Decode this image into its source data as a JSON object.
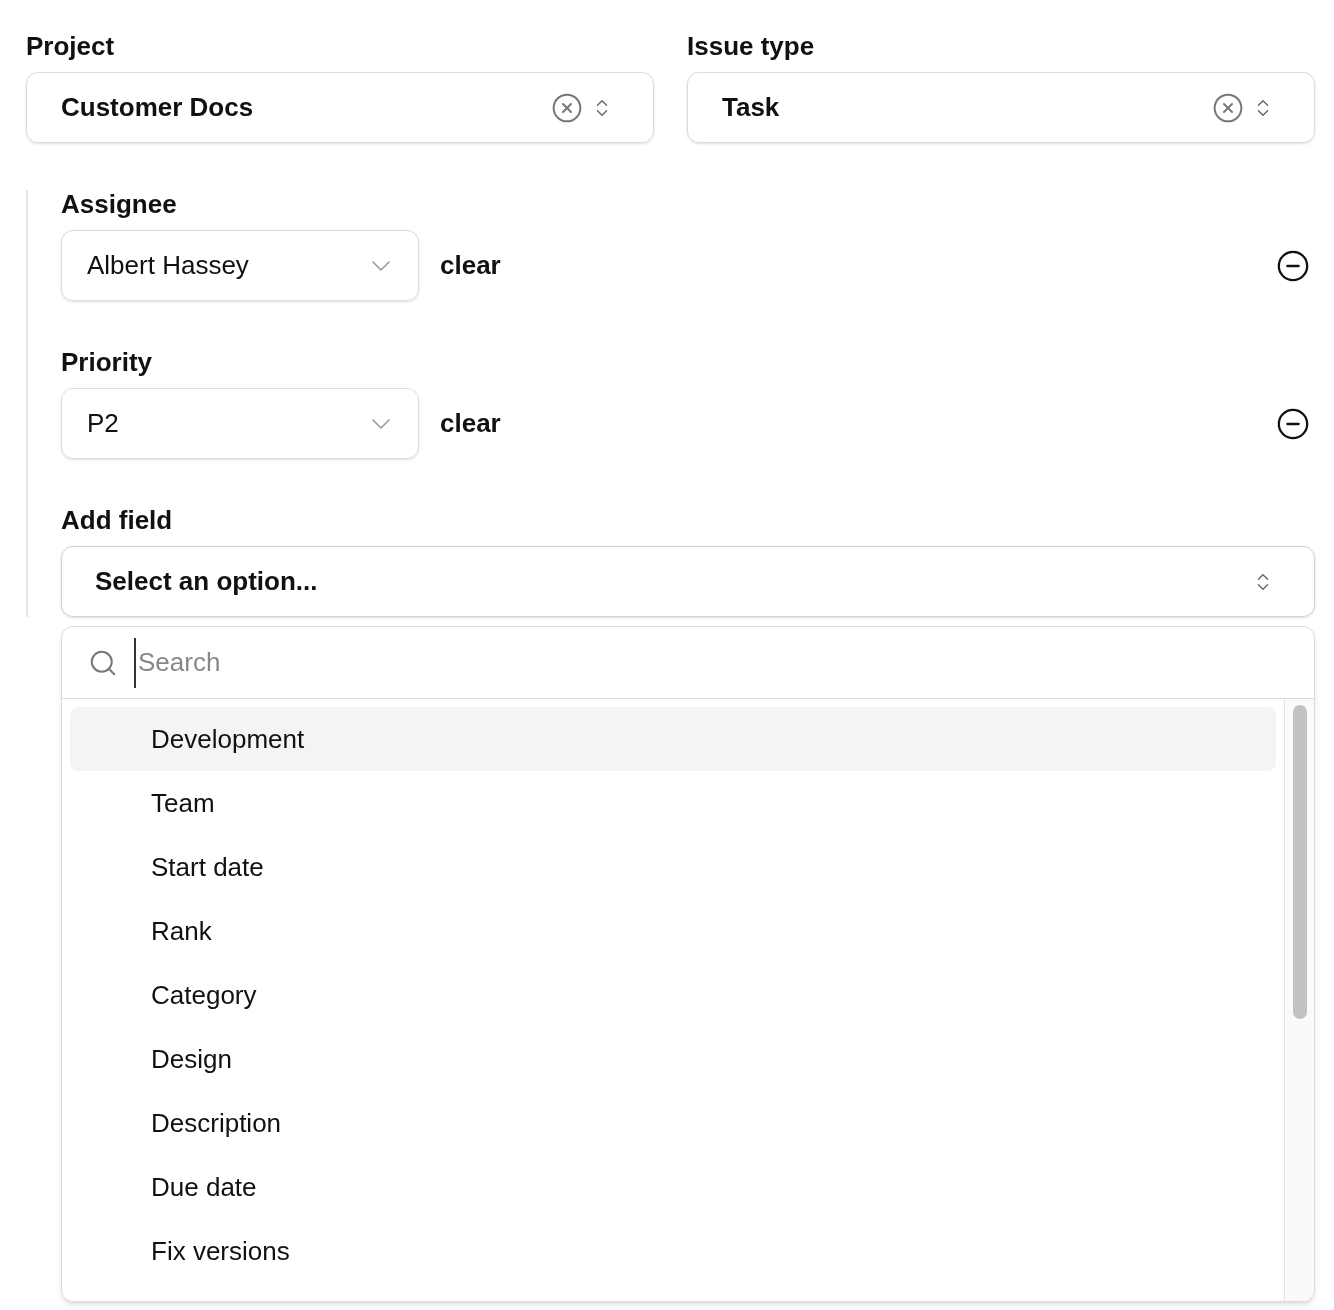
{
  "top_fields": [
    {
      "label": "Project",
      "value": "Customer Docs"
    },
    {
      "label": "Issue type",
      "value": "Task"
    }
  ],
  "fields": [
    {
      "label": "Assignee",
      "value": "Albert Hassey",
      "clear": "clear"
    },
    {
      "label": "Priority",
      "value": "P2",
      "clear": "clear"
    }
  ],
  "add_field": {
    "label": "Add field",
    "placeholder": "Select an option...",
    "expanded": true
  },
  "dropdown": {
    "search": {
      "placeholder": "Search"
    },
    "options": [
      {
        "label": "Development",
        "selected": true
      },
      {
        "label": "Team",
        "selected": false
      },
      {
        "label": "Start date",
        "selected": false
      },
      {
        "label": "Rank",
        "selected": false
      },
      {
        "label": "Category",
        "selected": false
      },
      {
        "label": "Design",
        "selected": false
      },
      {
        "label": "Description",
        "selected": false
      },
      {
        "label": "Due date",
        "selected": false
      },
      {
        "label": "Fix versions",
        "selected": false
      }
    ]
  }
}
